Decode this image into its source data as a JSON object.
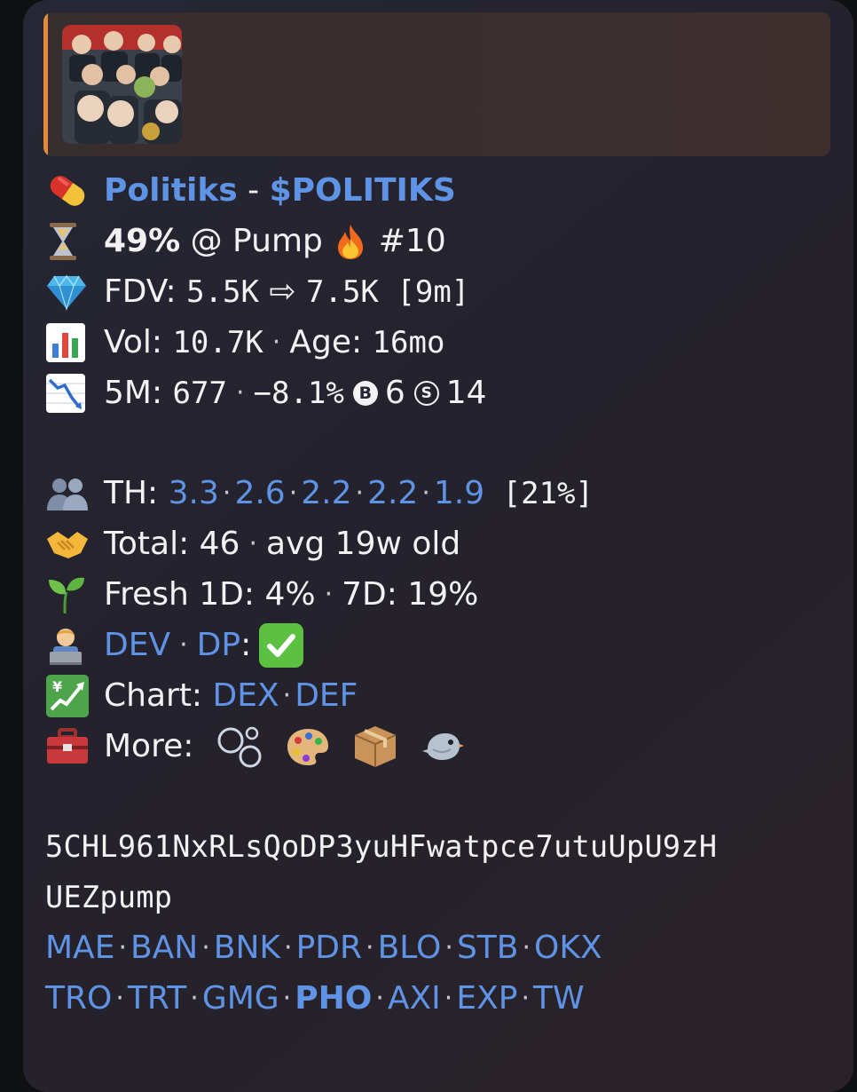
{
  "token": {
    "name": "Politiks",
    "separator": " - ",
    "ticker": "$POLITIKS"
  },
  "progress": {
    "percent": "49%",
    "at": " @ Pump ",
    "rank": " #10"
  },
  "fdv": {
    "label": "FDV: ",
    "from": "5.5K",
    "arrow": " ⇨ ",
    "to": "7.5K",
    "window": " [9m]"
  },
  "vol": {
    "label": "Vol: ",
    "value": "10.7K",
    "age_label": "Age: ",
    "age_value": "16mo"
  },
  "five_min": {
    "label": "5M: ",
    "value": "677",
    "change": "−8.1%",
    "buy_glyph": "B",
    "buys": "6",
    "sell_glyph": "S",
    "sells": "14"
  },
  "holders": {
    "label": "TH: ",
    "values": [
      "3.3",
      "2.6",
      "2.2",
      "2.2",
      "1.9"
    ],
    "total_pct": " [21%]"
  },
  "total": {
    "label": "Total: ",
    "value": "46",
    "avg": "avg 19w old"
  },
  "fresh": {
    "label": "Fresh 1D: ",
    "d1": "4%",
    "d7_label": "7D: ",
    "d7": "19%"
  },
  "dev": {
    "dev_link": "DEV",
    "dp_link": "DP",
    "dp_suffix": ":",
    "check": "✅"
  },
  "chart": {
    "label": "Chart: ",
    "links": [
      "DEX",
      "DEF"
    ]
  },
  "more": {
    "label": "More: ",
    "icons": [
      "bubbles-icon",
      "palette-icon",
      "package-icon",
      "bird-icon"
    ]
  },
  "contract_line1": "5CHL961NxRLsQoDP3yuHFwatpce7utuUpU9zH",
  "contract_line2": "UEZpump",
  "bots_row1": [
    "MAE",
    "BAN",
    "BNK",
    "PDR",
    "BLO",
    "STB",
    "OKX"
  ],
  "bots_row2": [
    "TRO",
    "TRT",
    "GMG",
    "PHO",
    "AXI",
    "EXP",
    "TW"
  ],
  "bots_row2_bold": "PHO",
  "colors": {
    "link": "#5f93e6",
    "reply_bar": "#e58a3a",
    "text": "#f2f2f4"
  }
}
